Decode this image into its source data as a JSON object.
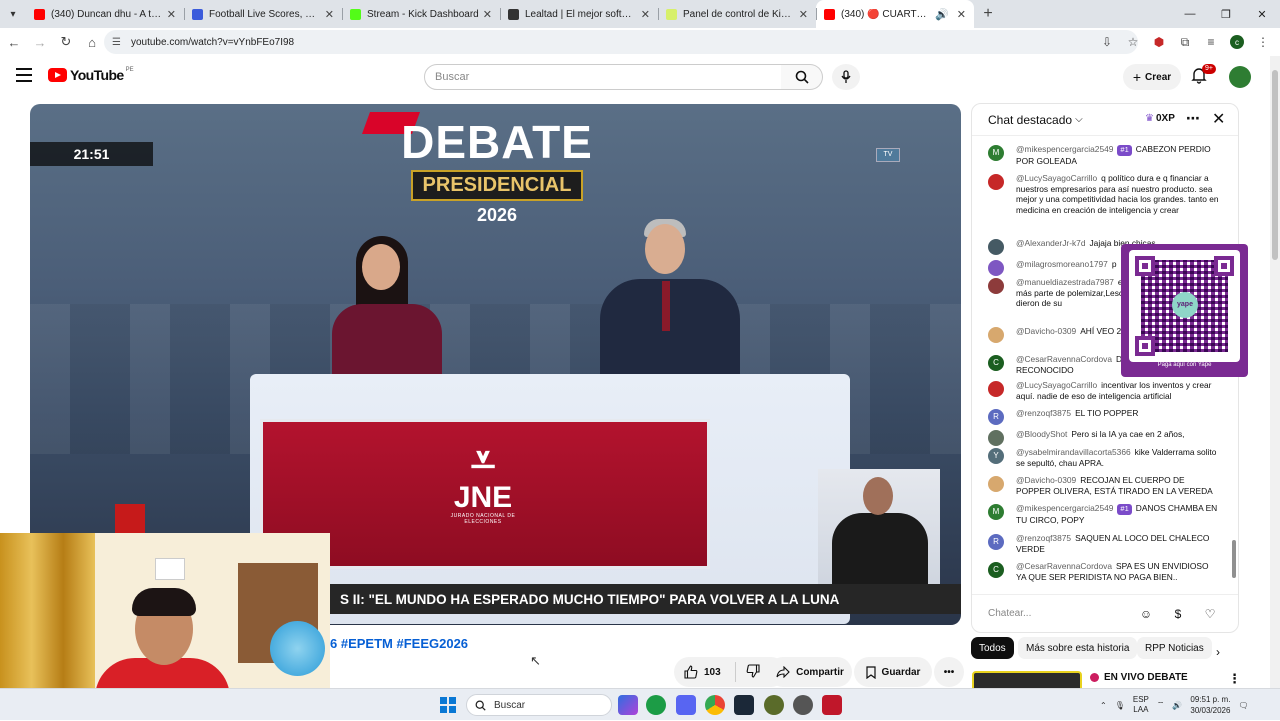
{
  "browser": {
    "tabs": [
      {
        "title": "(340) Duncan dhu - A tientas (li",
        "favicon_color": "#ff0000",
        "active": false
      },
      {
        "title": "Football Live Scores, Fixtures &",
        "favicon_color": "#3b5bdb",
        "active": false
      },
      {
        "title": "Stream - Kick Dashboard",
        "favicon_color": "#53fc18",
        "active": false
      },
      {
        "title": "Lealtad | El mejor software para",
        "favicon_color": "#333333",
        "active": false
      },
      {
        "title": "Panel de control de KickBot",
        "favicon_color": "#d7f06a",
        "active": false
      },
      {
        "title": "(340) 🔴 CUARTO DÍA DEL",
        "favicon_color": "#ff0000",
        "active": true
      }
    ],
    "new_tab": "+",
    "url": "youtube.com/watch?v=vYnbFEo7I98",
    "avatar_letter": "c"
  },
  "youtube": {
    "logo_text": "YouTube",
    "region": "PE",
    "search_placeholder": "Buscar",
    "create_label": "Crear",
    "notif_count": "9+"
  },
  "video": {
    "timer": "21:51",
    "title_line1": "DEBATE",
    "title_line2": "PRESIDENCIAL",
    "title_line3": "2026",
    "org_logo": "JNE",
    "org_caption": "JURADO NACIONAL DE ELECCIONES",
    "ticker": "S II: \"EL MUNDO HA ESPERADO MUCHO TIEMPO\" PARA VOLVER A LA LUNA",
    "hashtag_prefix": "6",
    "hashtags": "#EPETM #FEEG2026",
    "likes": "103",
    "share_label": "Compartir",
    "save_label": "Guardar"
  },
  "chat": {
    "title": "Chat destacado",
    "xp": "0XP",
    "input_placeholder": "Chatear...",
    "messages": [
      {
        "author": "@mikespencergarcia2549",
        "badge": "#1",
        "text": "CABEZON PERDIO POR GOLEADA",
        "avatar": "M",
        "color": "#2e7d32"
      },
      {
        "author": "@LucySayagoCarrillo",
        "badge": "",
        "text": "q político dura e q financiar a nuestros empresarios para así nuestro producto. sea mejor y una competitividad hacia los grandes. tanto en medicina en creación de inteligencia y crear",
        "avatar": "",
        "color": "#c62828"
      },
      {
        "author": "@AlexanderJr-k7d",
        "badge": "",
        "text": "Jajaja bien chicas",
        "avatar": "",
        "color": "#455a64"
      },
      {
        "author": "@milagrosmoreano1797",
        "badge": "",
        "text": "p",
        "avatar": "",
        "color": "#7e57c2"
      },
      {
        "author": "@manueldiazestrada7987",
        "badge": "",
        "text": "estrategia,es vivo nada más parte de polemizar,Lescano malhablado y le dieron de su",
        "avatar": "",
        "color": "#8d3b3b"
      },
      {
        "author": "@Davicho-0309",
        "badge": "",
        "text": "AHÍ VEO 2 PERIODISTA",
        "avatar": "",
        "color": "#d7a86e"
      },
      {
        "author": "@CesarRavennaCordova",
        "badge": "",
        "text": "DEL HIJO NO RECONOCIDO",
        "avatar": "C",
        "color": "#1b5e20"
      },
      {
        "author": "@LucySayagoCarrillo",
        "badge": "",
        "text": "incentivar los inventos y crear aquí. nadie de eso de inteligencia artificial",
        "avatar": "",
        "color": "#c62828"
      },
      {
        "author": "@renzoqf3875",
        "badge": "",
        "text": "EL TIO POPPER",
        "avatar": "R",
        "color": "#5c6bc0"
      },
      {
        "author": "@BloodyShot",
        "badge": "",
        "text": "Pero si la IA ya cae en 2 años,",
        "avatar": "",
        "color": "#607060"
      },
      {
        "author": "@ysabelmirandavillacorta5366",
        "badge": "",
        "text": "kike Valderrama solito se sepultó, chau APRA.",
        "avatar": "Y",
        "color": "#546e7a"
      },
      {
        "author": "@Davicho-0309",
        "badge": "",
        "text": "RECOJAN EL CUERPO DE POPPER OLIVERA, ESTÁ TIRADO EN LA VEREDA",
        "avatar": "",
        "color": "#d7a86e"
      },
      {
        "author": "@mikespencergarcia2549",
        "badge": "#1",
        "text": "DANOS CHAMBA EN TU CIRCO, POPY",
        "avatar": "M",
        "color": "#2e7d32"
      },
      {
        "author": "@renzoqf3875",
        "badge": "",
        "text": "SAQUEN AL LOCO DEL CHALECO VERDE",
        "avatar": "R",
        "color": "#5c6bc0"
      },
      {
        "author": "@CesarRavennaCordova",
        "badge": "",
        "text": "SPA ES UN ENVIDIOSO YA QUE SER PERIDISTA NO PAGA BIEN..",
        "avatar": "C",
        "color": "#1b5e20"
      }
    ]
  },
  "qr": {
    "center": "yape",
    "caption": "Paga aquí con Yape"
  },
  "chips": [
    "Todos",
    "Más sobre esta historia",
    "RPP Noticias"
  ],
  "recommendation": {
    "title": "EN VIVO DEBATE"
  },
  "taskbar": {
    "search_placeholder": "Buscar",
    "lang1": "ESP",
    "lang2": "LAA",
    "time": "09:51 p. m.",
    "date": "30/03/2026"
  }
}
